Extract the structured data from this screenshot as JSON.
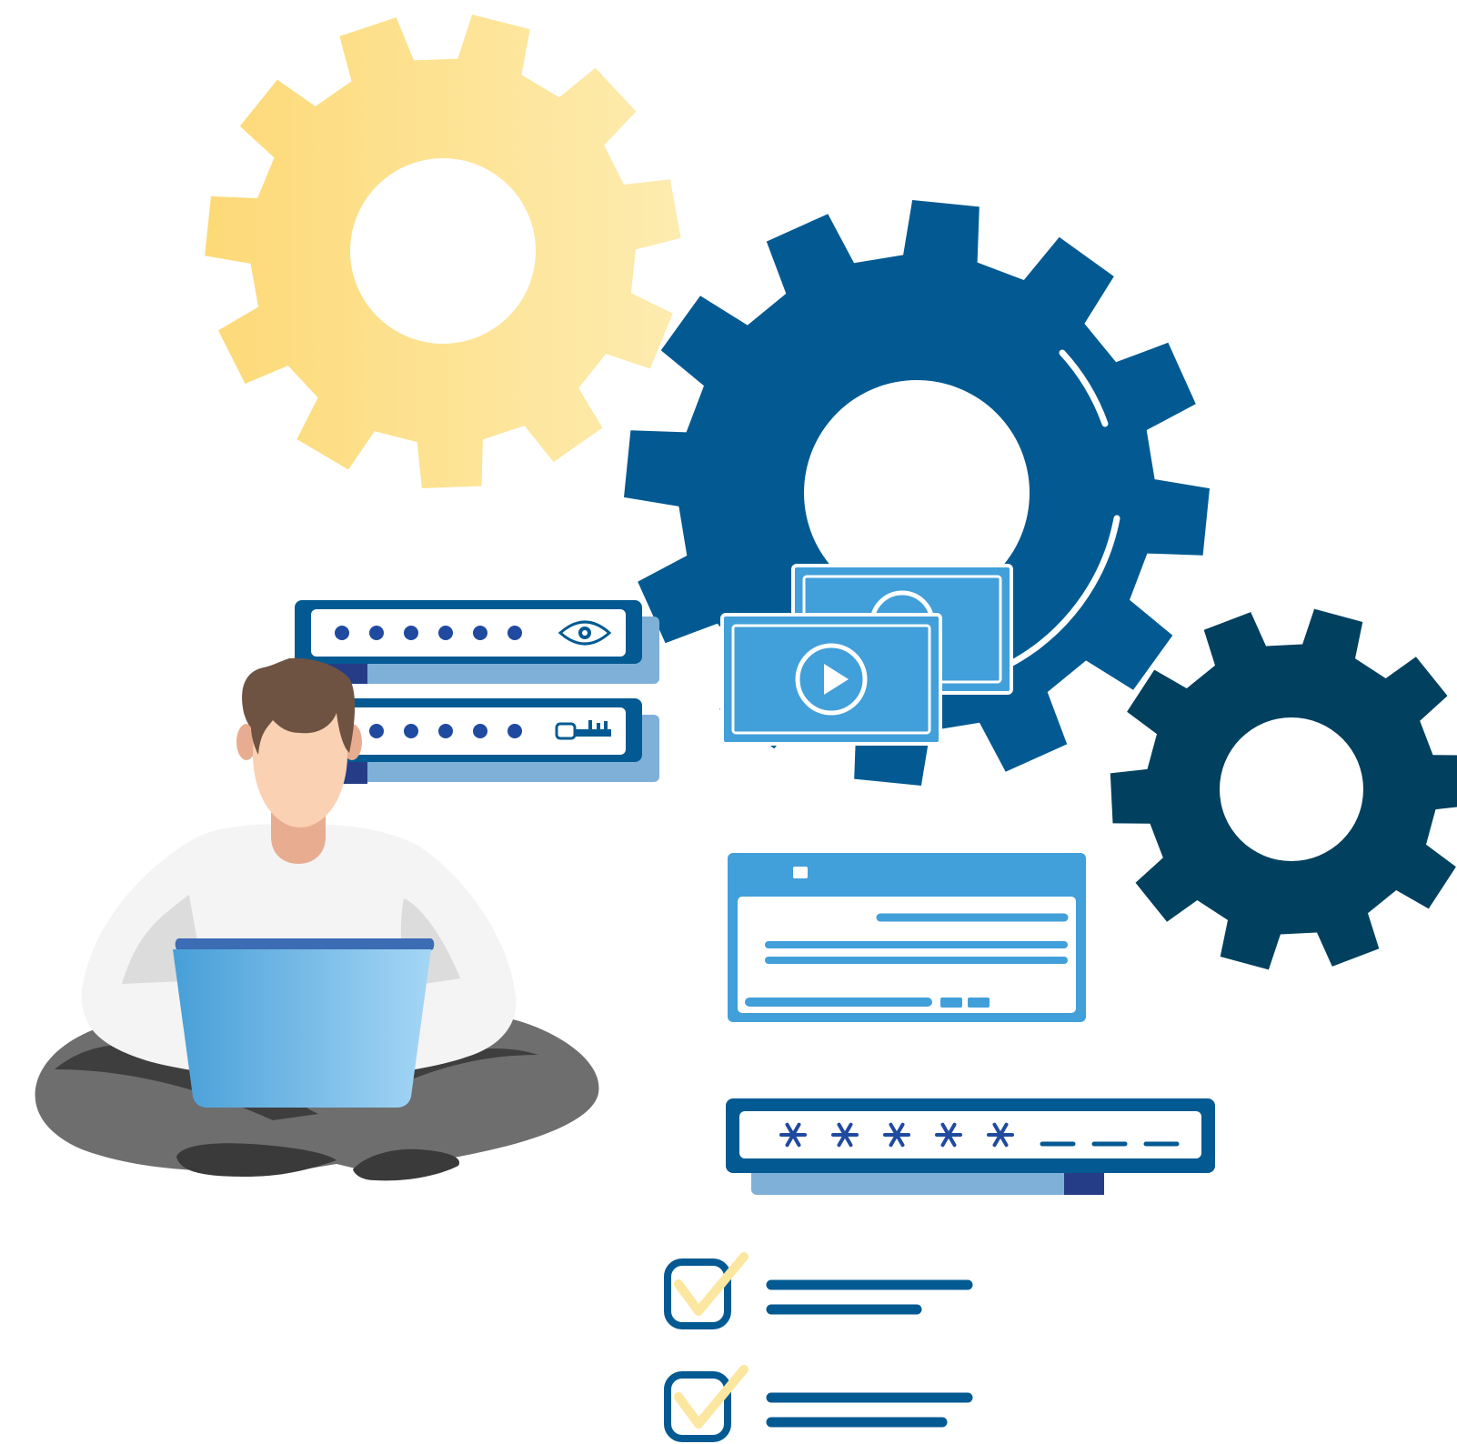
{
  "illustration": {
    "subject": "person-with-laptop-among-gears",
    "visible_text": []
  },
  "colors": {
    "background": "#ffffff",
    "gear_yellow_start": "#fdd977",
    "gear_yellow_end": "#fdecb0",
    "gear_blue": "#035a92",
    "gear_navy": "#02405f",
    "panel_blue": "#419fd9",
    "panel_light_blue": "#7fb0d8",
    "navy_accent": "#253d87",
    "dot_blue": "#1f4aa0",
    "check_yellow": "#fce7a0",
    "skin": "#fad1b2",
    "neck": "#e8ad90",
    "hair": "#6e5342",
    "shirt": "#f4f4f4",
    "shirt_shadow": "#dcdcdc",
    "pants": "#6e6e6e",
    "pants_dark": "#3e3e3e",
    "laptop_start": "#479fd8",
    "laptop_end": "#a5d6f5"
  },
  "icons": {
    "gears": [
      "gear-icon",
      "gear-icon",
      "gear-icon"
    ],
    "password_fields": [
      "eye-icon",
      "key-icon"
    ],
    "media": "play-icon",
    "checkbox": "checkmark-icon"
  },
  "password_fields": [
    {
      "dots": 6,
      "icon": "eye-icon"
    },
    {
      "dots": 6,
      "icon": "key-icon"
    }
  ],
  "masked_field": {
    "asterisks": 5,
    "dashes": 3
  },
  "checklist": [
    {
      "checked": true
    },
    {
      "checked": true
    }
  ]
}
